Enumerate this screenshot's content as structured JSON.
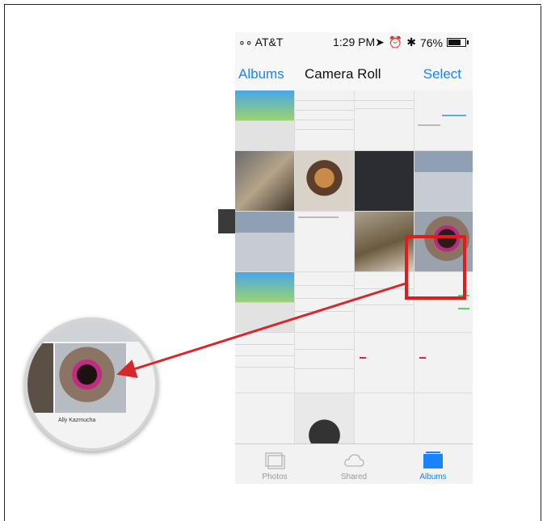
{
  "status_bar": {
    "carrier": "∘∘ AT&T",
    "time": "1:29 PM",
    "battery": "76%"
  },
  "nav": {
    "back_label": "Albums",
    "title": "Camera Roll",
    "select_label": "Select"
  },
  "tabs": [
    {
      "label": "Photos",
      "icon": "photos-icon",
      "active": false
    },
    {
      "label": "Shared",
      "icon": "cloud-icon",
      "active": false
    },
    {
      "label": "Albums",
      "icon": "albums-icon",
      "active": true
    }
  ],
  "magnifier": {
    "name": "Ally Kazmucha"
  },
  "colors": {
    "accent": "#1a82fb",
    "highlight": "#e21b1b"
  }
}
